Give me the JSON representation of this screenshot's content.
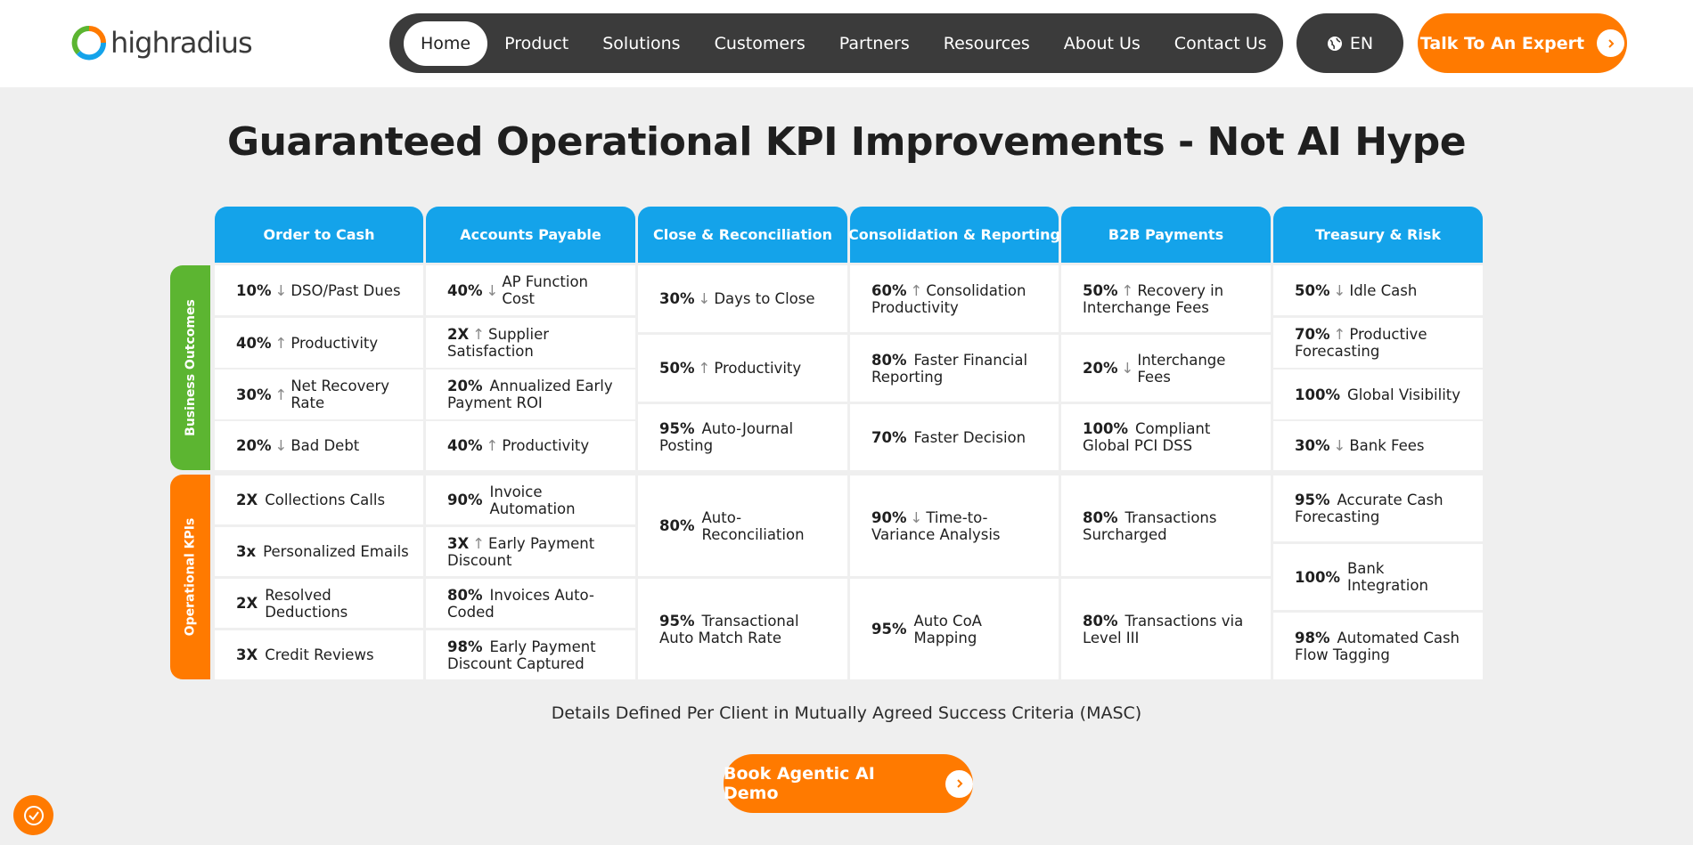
{
  "header": {
    "logo_text": "highradius",
    "nav": [
      "Home",
      "Product",
      "Solutions",
      "Customers",
      "Partners",
      "Resources",
      "About Us",
      "Contact Us"
    ],
    "lang": "EN",
    "cta": "Talk To An Expert"
  },
  "title": "Guaranteed Operational KPI Improvements - Not AI Hype",
  "sections": {
    "business": "Business Outcomes",
    "operational": "Operational KPIs"
  },
  "columns": [
    "Order to Cash",
    "Accounts Payable",
    "Close & Reconciliation",
    "Consolidation & Reporting",
    "B2B Payments",
    "Treasury & Risk"
  ],
  "table": {
    "c0": [
      {
        "v": "10%",
        "a": "↓",
        "t": "DSO/Past Dues"
      },
      {
        "v": "40%",
        "a": "↑",
        "t": "Productivity"
      },
      {
        "v": "30%",
        "a": "↑",
        "t": "Net Recovery Rate"
      },
      {
        "v": "20%",
        "a": "↓",
        "t": "Bad Debt"
      },
      {
        "v": "2X",
        "a": "",
        "t": "Collections Calls"
      },
      {
        "v": "3x",
        "a": "",
        "t": "Personalized Emails"
      },
      {
        "v": "2X",
        "a": "",
        "t": "Resolved Deductions"
      },
      {
        "v": "3X",
        "a": "",
        "t": "Credit Reviews"
      }
    ],
    "c1": [
      {
        "v": "40%",
        "a": "↓",
        "t": "AP Function Cost"
      },
      {
        "v": "2X",
        "a": "↑",
        "t": "Supplier Satisfaction"
      },
      {
        "v": "20%",
        "a": "",
        "t": "Annualized Early Payment ROI"
      },
      {
        "v": "40%",
        "a": "↑",
        "t": "Productivity"
      },
      {
        "v": "90%",
        "a": "",
        "t": "Invoice Automation"
      },
      {
        "v": "3X",
        "a": "↑",
        "t": "Early Payment Discount"
      },
      {
        "v": "80%",
        "a": "",
        "t": "Invoices Auto-Coded"
      },
      {
        "v": "98%",
        "a": "",
        "t": "Early Payment Discount Captured"
      }
    ],
    "c2": [
      {
        "v": "30%",
        "a": "↓",
        "t": "Days to Close"
      },
      {
        "v": "50%",
        "a": "↑",
        "t": "Productivity"
      },
      {
        "v": "95%",
        "a": "",
        "t": "Auto-Journal Posting"
      },
      {
        "v": "80%",
        "a": "",
        "t": "Auto-Reconciliation"
      },
      {
        "v": "95%",
        "a": "",
        "t": "Transactional Auto Match Rate"
      }
    ],
    "c3": [
      {
        "v": "60%",
        "a": "↑",
        "t": "Consolidation Productivity"
      },
      {
        "v": "80%",
        "a": "",
        "t": "Faster Financial Reporting"
      },
      {
        "v": "70%",
        "a": "",
        "t": "Faster Decision"
      },
      {
        "v": "90%",
        "a": "↓",
        "t": "Time-to-Variance Analysis"
      },
      {
        "v": "95%",
        "a": "",
        "t": "Auto CoA Mapping"
      }
    ],
    "c4": [
      {
        "v": "50%",
        "a": "↑",
        "t": "Recovery in Interchange Fees"
      },
      {
        "v": "20%",
        "a": "↓",
        "t": "Interchange Fees"
      },
      {
        "v": "100%",
        "a": "",
        "t": "Compliant Global PCI DSS"
      },
      {
        "v": "80%",
        "a": "",
        "t": "Transactions Surcharged"
      },
      {
        "v": "80%",
        "a": "",
        "t": "Transactions via Level III"
      }
    ],
    "c5": [
      {
        "v": "50%",
        "a": "↓",
        "t": "Idle Cash"
      },
      {
        "v": "70%",
        "a": "↑",
        "t": "Productive Forecasting"
      },
      {
        "v": "100%",
        "a": "",
        "t": "Global Visibility"
      },
      {
        "v": "30%",
        "a": "↓",
        "t": "Bank Fees"
      },
      {
        "v": "95%",
        "a": "",
        "t": "Accurate Cash Forecasting"
      },
      {
        "v": "100%",
        "a": "",
        "t": "Bank Integration"
      },
      {
        "v": "98%",
        "a": "",
        "t": "Automated Cash Flow Tagging"
      }
    ]
  },
  "note": "Details Defined Per Client in Mutually Agreed Success Criteria (MASC)",
  "cta_bottom": "Book Agentic AI Demo",
  "colors": {
    "orange": "#ff7a00",
    "blue": "#14a3ea",
    "green": "#5cb531",
    "nav": "#3b3b3b"
  }
}
